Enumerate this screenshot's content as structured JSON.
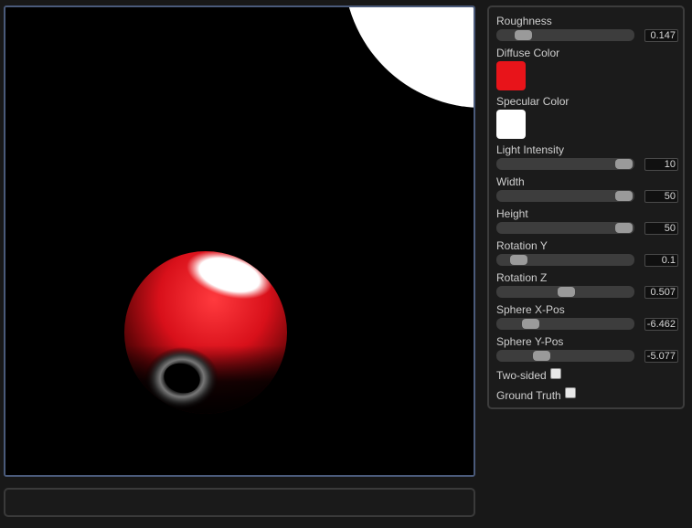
{
  "controls": {
    "roughness": {
      "label": "Roughness",
      "value": "0.147",
      "fraction": 0.14
    },
    "diffuse": {
      "label": "Diffuse Color",
      "color": "#e8141a"
    },
    "specular": {
      "label": "Specular Color",
      "color": "#ffffff"
    },
    "light_intensity": {
      "label": "Light Intensity",
      "value": "10",
      "fraction": 1.0
    },
    "width": {
      "label": "Width",
      "value": "50",
      "fraction": 1.0
    },
    "height": {
      "label": "Height",
      "value": "50",
      "fraction": 1.0
    },
    "rotation_y": {
      "label": "Rotation Y",
      "value": "0.1",
      "fraction": 0.1
    },
    "rotation_z": {
      "label": "Rotation Z",
      "value": "0.507",
      "fraction": 0.51
    },
    "sphere_x": {
      "label": "Sphere X-Pos",
      "value": "-6.462",
      "fraction": 0.2
    },
    "sphere_y": {
      "label": "Sphere Y-Pos",
      "value": "-5.077",
      "fraction": 0.3
    },
    "two_sided": {
      "label": "Two-sided",
      "checked": false
    },
    "ground_truth": {
      "label": "Ground Truth",
      "checked": false
    }
  },
  "status": {
    "text": ""
  }
}
